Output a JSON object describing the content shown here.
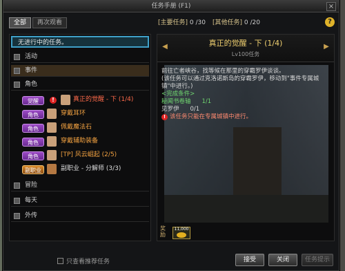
{
  "window": {
    "title": "任务手册 (F1)"
  },
  "tabs": [
    "全部",
    "再次观看"
  ],
  "counters": {
    "main_label": "[主要任务]",
    "main_value": "0 /30",
    "other_label": "[其他任务]",
    "other_value": "0 /20"
  },
  "list": {
    "unstarted": "无进行中的任务。",
    "categories": {
      "activity": "活动",
      "event": "事件",
      "role": "角色",
      "adventure": "冒险",
      "daily": "每天",
      "side": "外传"
    },
    "tasks": [
      {
        "badge": "觉醒",
        "label": "真正的觉醒 - 下 (1/4)",
        "alert": true
      },
      {
        "badge": "角色",
        "label": "穿戴耳环"
      },
      {
        "badge": "角色",
        "label": "佩戴魔法石"
      },
      {
        "badge": "角色",
        "label": "穿戴辅助装备"
      },
      {
        "badge": "角色",
        "label": "[TP] 风云崛起 (2/5)"
      },
      {
        "badge": "副职业",
        "label": "副职业 - 分解师 (3/3)"
      }
    ]
  },
  "detail": {
    "title": "真正的觉醒 - 下 (1/4)",
    "level": "Lv100任务",
    "line1": "前往亡者峡谷，找等候在那里的穿霸罗伊谈谈。",
    "line2": "(该任务可以通过克洛诺斯岛的穿霸罗伊，移动到\"事件专属城镇\"中进行。)",
    "complete_label": "<完成条件>",
    "cond1_label": "秘闻书卷轴",
    "cond1_value": "1/1",
    "cond2_label": "见罗伊",
    "cond2_value": "0/1",
    "warning": "该任务只能在专属城镇中进行。",
    "reward_label": "奖励",
    "reward_count": "11,000"
  },
  "footer": {
    "recommend": "只查看推荐任务",
    "accept": "接受",
    "close": "关闭",
    "hint": "任务提示"
  }
}
